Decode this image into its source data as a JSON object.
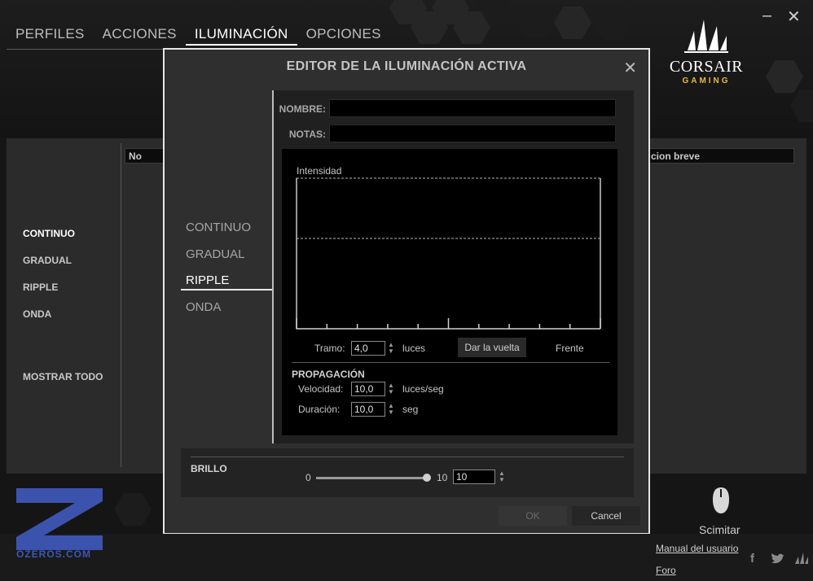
{
  "nav": {
    "tabs": [
      "PERFILES",
      "ACCIONES",
      "ILUMINACIÓN",
      "OPCIONES"
    ],
    "active": "ILUMINACIÓN"
  },
  "window": {
    "minimize": "–",
    "close": "✕"
  },
  "brand": {
    "name": "CORSAIR",
    "sub": "GAMING",
    "accent_color": "#e8b84a"
  },
  "sidebar": {
    "items": [
      "CONTINUO",
      "GRADUAL",
      "RIPPLE",
      "ONDA"
    ],
    "active": "CONTINUO",
    "show_all": "MOSTRAR TODO"
  },
  "table": {
    "columns": [
      "No",
      "cion breve"
    ]
  },
  "modal": {
    "title": "EDITOR DE LA ILUMINACIÓN ACTIVA",
    "close": "✕",
    "effects": [
      "CONTINUO",
      "GRADUAL",
      "RIPPLE",
      "ONDA"
    ],
    "active_effect": "RIPPLE",
    "fields": {
      "name_label": "NOMBRE:",
      "name_value": "",
      "notes_label": "NOTAS:",
      "notes_value": ""
    },
    "graph": {
      "label": "Intensidad",
      "tramo_label": "Tramo:",
      "tramo_value": "4,0",
      "tramo_unit": "luces",
      "flip_button": "Dar la vuelta",
      "front_label": "Frente"
    },
    "propagation": {
      "title": "PROPAGACIÓN",
      "speed_label": "Velocidad:",
      "speed_value": "10,0",
      "speed_unit": "luces/seg",
      "duration_label": "Duración:",
      "duration_value": "10,0",
      "duration_unit": "seg"
    },
    "brightness": {
      "label": "BRILLO",
      "min": "0",
      "max": "10",
      "value": "10",
      "level_fraction": 1.0
    },
    "buttons": {
      "ok": "OK",
      "cancel": "Cancel"
    }
  },
  "device": {
    "name": "Scimitar"
  },
  "footer": {
    "manual": "Manual del usuario",
    "forum": "Foro",
    "social_icons": [
      "facebook-icon",
      "twitter-icon",
      "corsair-icon"
    ]
  },
  "watermark": {
    "text": "OZEROS.COM",
    "color": "#3e56b5"
  }
}
